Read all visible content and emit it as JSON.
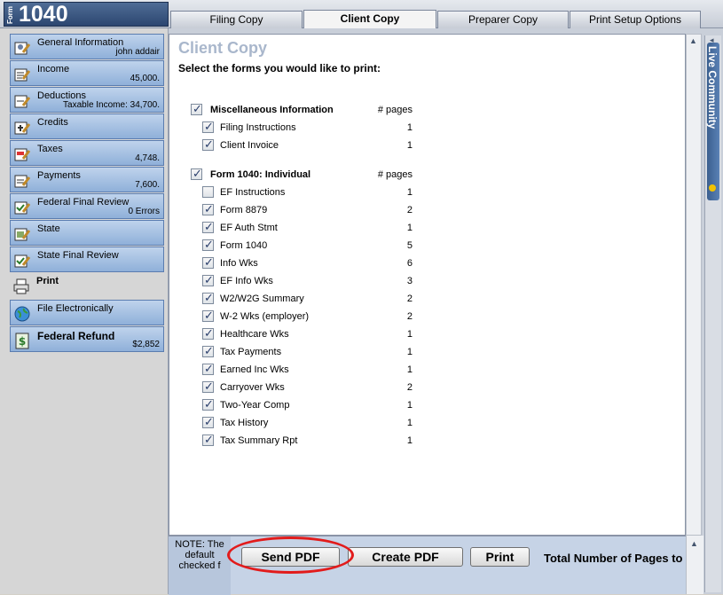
{
  "app": {
    "logo_form": "Form",
    "logo_number": "1040"
  },
  "tabs": [
    {
      "label": "Filing Copy"
    },
    {
      "label": "Client Copy"
    },
    {
      "label": "Preparer Copy"
    },
    {
      "label": "Print Setup Options"
    }
  ],
  "sidebar": {
    "items": [
      {
        "label": "General Information",
        "sub": "john addair"
      },
      {
        "label": "Income",
        "sub": "45,000."
      },
      {
        "label": "Deductions",
        "sub": "Taxable Income: 34,700."
      },
      {
        "label": "Credits",
        "sub": ""
      },
      {
        "label": "Taxes",
        "sub": "4,748."
      },
      {
        "label": "Payments",
        "sub": "7,600."
      },
      {
        "label": "Federal Final Review",
        "sub": "0 Errors"
      },
      {
        "label": "State",
        "sub": ""
      },
      {
        "label": "State Final Review",
        "sub": ""
      },
      {
        "label": "Print",
        "sub": ""
      },
      {
        "label": "File Electronically",
        "sub": ""
      },
      {
        "label": "Federal Refund",
        "sub": "$2,852"
      }
    ]
  },
  "main": {
    "title": "Client Copy",
    "subtitle": "Select the forms you would like to print:",
    "pages_header": "# pages",
    "groups": [
      {
        "name": "Miscellaneous Information",
        "items": [
          {
            "name": "Filing Instructions",
            "pages": "1",
            "checked": true
          },
          {
            "name": "Client Invoice",
            "pages": "1",
            "checked": true
          }
        ]
      },
      {
        "name": "Form 1040: Individual",
        "items": [
          {
            "name": "EF Instructions",
            "pages": "1",
            "checked": false
          },
          {
            "name": "Form 8879",
            "pages": "2",
            "checked": true
          },
          {
            "name": "EF Auth Stmt",
            "pages": "1",
            "checked": true
          },
          {
            "name": "Form 1040",
            "pages": "5",
            "checked": true
          },
          {
            "name": "Info Wks",
            "pages": "6",
            "checked": true
          },
          {
            "name": "EF Info Wks",
            "pages": "3",
            "checked": true
          },
          {
            "name": "W2/W2G Summary",
            "pages": "2",
            "checked": true
          },
          {
            "name": "W-2 Wks (employer)",
            "pages": "2",
            "checked": true
          },
          {
            "name": "Healthcare Wks",
            "pages": "1",
            "checked": true
          },
          {
            "name": "Tax Payments",
            "pages": "1",
            "checked": true
          },
          {
            "name": "Earned Inc Wks",
            "pages": "1",
            "checked": true
          },
          {
            "name": "Carryover Wks",
            "pages": "2",
            "checked": true
          },
          {
            "name": "Two-Year Comp",
            "pages": "1",
            "checked": true
          },
          {
            "name": "Tax History",
            "pages": "1",
            "checked": true
          },
          {
            "name": "Tax Summary Rpt",
            "pages": "1",
            "checked": true
          }
        ]
      }
    ]
  },
  "bottom": {
    "note": "NOTE: The default checked f",
    "send_pdf": "Send PDF",
    "create_pdf": "Create PDF",
    "print": "Print",
    "total_label": "Total Number of Pages to"
  },
  "live_community": "Live Community",
  "colors": {
    "highlight": "#e21b1b",
    "nav_blue": "#8fb0d9",
    "title": "#a9b7cc"
  }
}
